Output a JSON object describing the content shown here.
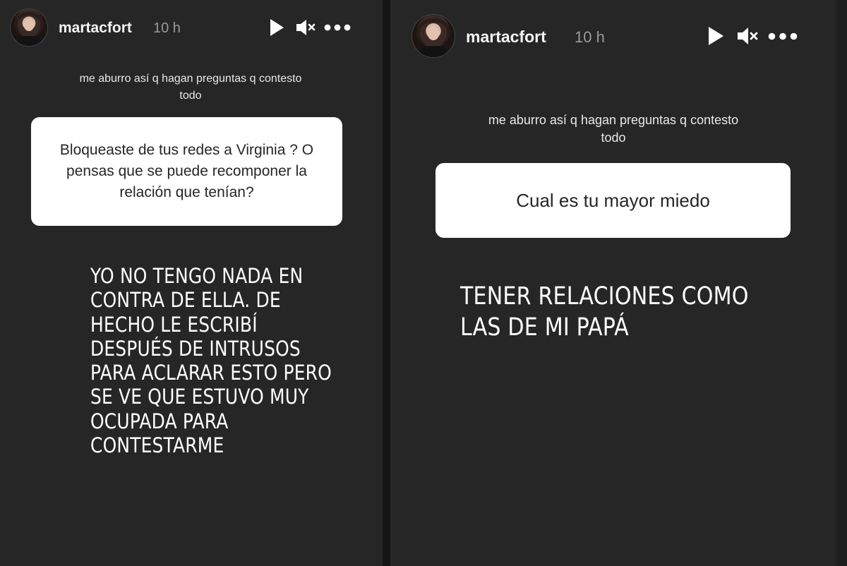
{
  "stories": [
    {
      "username": "martacfort",
      "time": "10 h",
      "prompt": "me aburro así q hagan preguntas q contesto todo",
      "question": "Bloqueaste de tus redes a Virginia ? O pensas que se puede recomponer la relación que tenían?",
      "answer": "YO NO TENGO NADA EN\nCONTRA DE ELLA. DE\nHECHO LE ESCRIBÍ\nDESPUÉS DE INTRUSOS\nPARA ACLARAR ESTO PERO\nSE VE QUE ESTUVO MUY\nOCUPADA PARA\nCONTESTARME",
      "icons": [
        "play-icon",
        "mute-icon",
        "more-icon"
      ]
    },
    {
      "username": "martacfort",
      "time": "10 h",
      "prompt": "me aburro así q hagan preguntas q contesto todo",
      "question": "Cual es tu mayor miedo",
      "answer": "TENER RELACIONES COMO\nLAS DE MI PAPÁ",
      "icons": [
        "play-icon",
        "mute-icon",
        "more-icon"
      ]
    }
  ],
  "colors": {
    "story_bg": "#262626",
    "card_bg": "#ffffff",
    "text_primary": "#ffffff",
    "text_muted": "#9a9a9a"
  }
}
